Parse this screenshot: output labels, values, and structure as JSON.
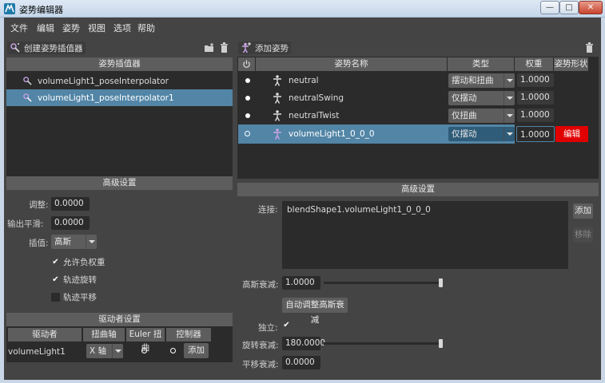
{
  "window": {
    "title": "姿势编辑器",
    "btn_min": "—",
    "btn_max": "□",
    "btn_close": "✕"
  },
  "menu": [
    "文件",
    "编辑",
    "姿势",
    "视图",
    "选项",
    "帮助"
  ],
  "left": {
    "create_btn": "创建姿势插值器",
    "list_header": "姿势插值器",
    "interpolators": [
      "volumeLight1_poseInterpolator",
      "volumeLight1_poseInterpolator1"
    ],
    "selected_index": 1,
    "advanced": {
      "header": "高级设置",
      "adjust_label": "调整:",
      "adjust_value": "0.0000",
      "smooth_label": "输出平滑:",
      "smooth_value": "0.0000",
      "interp_label": "插值:",
      "interp_value": "高斯",
      "chk_negative": "允许负权重",
      "chk_rotate": "轨迹旋转",
      "chk_translate": "轨迹平移"
    },
    "driver": {
      "header": "驱动者设置",
      "columns": [
        "驱动者",
        "扭曲轴",
        "Euler 扭曲",
        "控制器"
      ],
      "row": {
        "driver": "volumeLight1",
        "axis": "X 轴",
        "add": "添加"
      }
    }
  },
  "right": {
    "add_pose_btn": "添加姿势",
    "columns": {
      "name": "姿势名称",
      "type": "类型",
      "weight": "权重",
      "shape": "姿势形状"
    },
    "poses": [
      {
        "name": "neutral",
        "type": "摆动和扭曲",
        "weight": "1.0000"
      },
      {
        "name": "neutralSwing",
        "type": "仅摆动",
        "weight": "1.0000"
      },
      {
        "name": "neutralTwist",
        "type": "仅扭曲",
        "weight": "1.0000"
      },
      {
        "name": "volumeLight1_0_0_0",
        "type": "仅摆动",
        "weight": "1.0000",
        "shape": "编辑"
      }
    ],
    "advanced": {
      "header": "高级设置",
      "connect_label": "连接:",
      "connect_value": "blendShape1.volumeLight1_0_0_0",
      "add_btn": "添加",
      "remove_btn": "移除",
      "gauss_label": "高斯衰减:",
      "gauss_value": "1.0000",
      "auto_btn": "自动调整高斯衰减",
      "indep_label": "独立:",
      "rot_label": "旋转衰减:",
      "rot_value": "180.0000",
      "trans_label": "平移衰减:",
      "trans_value": "0.0000"
    }
  },
  "colors": {
    "selection": "#5285a6",
    "edit_button": "#e00000",
    "background": "#444444"
  }
}
